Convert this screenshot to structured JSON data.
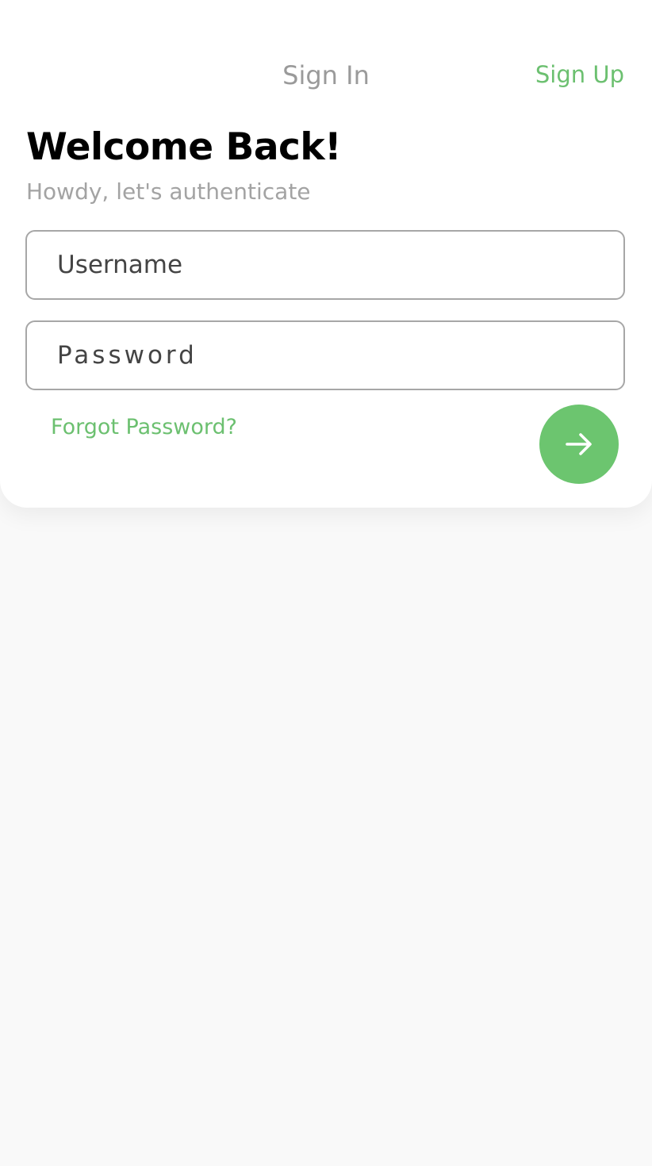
{
  "header": {
    "title": "Sign In",
    "signup_label": "Sign Up"
  },
  "welcome": {
    "heading": "Welcome Back!",
    "subheading": "Howdy, let's authenticate"
  },
  "form": {
    "username_placeholder": "Username",
    "username_value": "",
    "password_placeholder": "Password",
    "password_value": "",
    "forgot_label": "Forgot Password?",
    "submit_icon": "arrow-right-icon"
  },
  "colors": {
    "accent": "#6cc56f",
    "background": "#f9f9f9",
    "card": "#ffffff",
    "muted_text": "#9a9a9a"
  }
}
